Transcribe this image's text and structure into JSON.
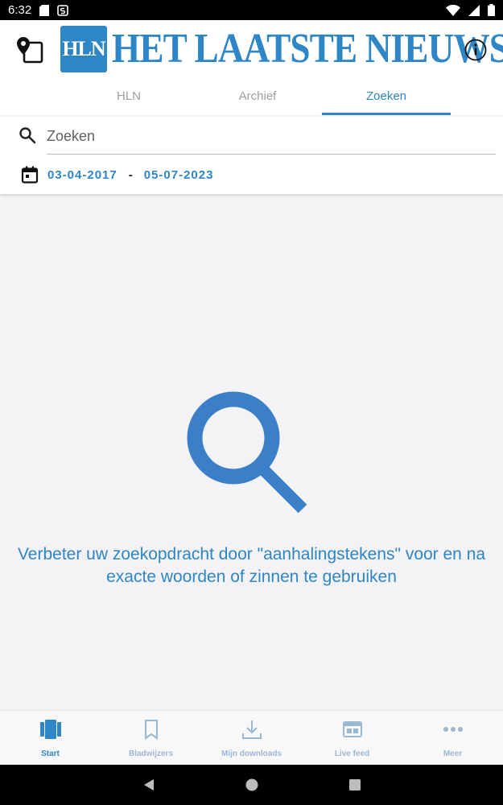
{
  "status_bar": {
    "time": "6:32"
  },
  "header": {
    "logo_badge": "HLN",
    "logo_title": "HET LAATSTE NIEUWS",
    "tabs": [
      {
        "label": "HLN",
        "active": false
      },
      {
        "label": "Archief",
        "active": false
      },
      {
        "label": "Zoeken",
        "active": true
      }
    ]
  },
  "search": {
    "placeholder": "Zoeken",
    "value": "",
    "date_from": "03-04-2017",
    "date_separator": "-",
    "date_to": "05-07-2023"
  },
  "empty_state": {
    "icon": "search-icon",
    "message": "Verbeter uw zoekopdracht door \"aanhalingstekens\" voor en na exacte woorden of zinnen te gebruiken"
  },
  "bottom_nav": {
    "items": [
      {
        "label": "Start",
        "icon": "start-icon",
        "active": true
      },
      {
        "label": "Bladwijzers",
        "icon": "bookmark-icon",
        "active": false
      },
      {
        "label": "Mijn downloads",
        "icon": "download-icon",
        "active": false
      },
      {
        "label": "Live feed",
        "icon": "live-feed-icon",
        "active": false
      },
      {
        "label": "Meer",
        "icon": "more-icon",
        "active": false
      }
    ]
  },
  "colors": {
    "accent": "#2e86c7",
    "inactive_nav": "#9ab7d4",
    "background": "#f3f2f4"
  }
}
